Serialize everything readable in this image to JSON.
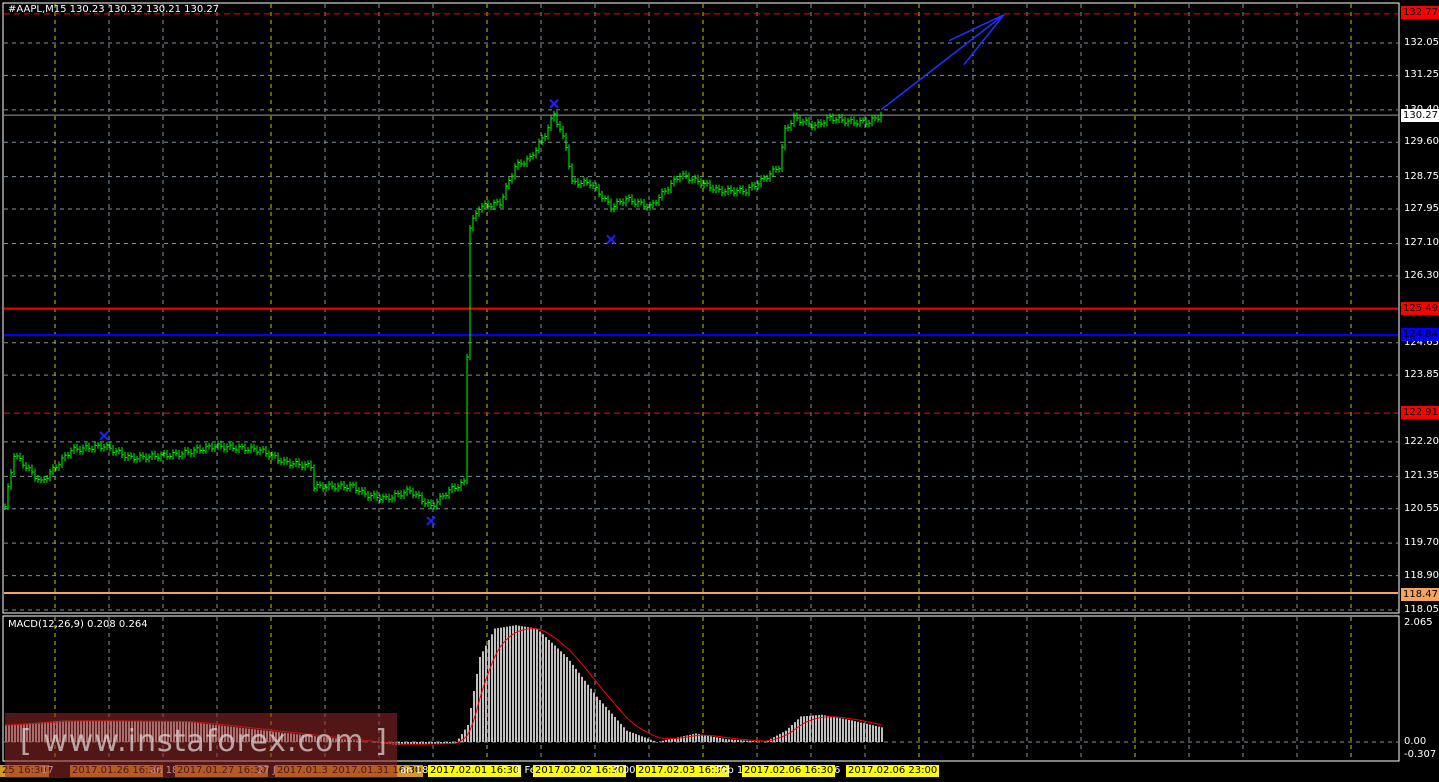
{
  "header": {
    "symbol_info": "#AAPL,M15  130.23 130.32 130.21 130.27"
  },
  "macd": {
    "label": "MACD(12,26,9) 0.208 0.264",
    "axis": [
      "2.065",
      "0.00",
      "-0.307"
    ]
  },
  "price_axis": [
    "132.05",
    "131.25",
    "130.40",
    "129.60",
    "128.75",
    "127.95",
    "127.10",
    "126.30",
    "124.65",
    "123.85",
    "122.20",
    "121.35",
    "120.55",
    "119.70",
    "118.90",
    "118.05"
  ],
  "levels": {
    "target": {
      "value": "132.77",
      "color": "#ff0000"
    },
    "current": {
      "value": "130.27",
      "color": "#ffffff"
    },
    "resistance": {
      "value": "125.49",
      "color": "#ff0000"
    },
    "pivot": {
      "value": "124.84",
      "color": "#0000ff"
    },
    "support_dashed": {
      "value": "122.91",
      "color": "#ff0000"
    },
    "support": {
      "value": "118.47",
      "color": "#f4a460"
    }
  },
  "time_axis": [
    {
      "t": "25 16:30",
      "bg": "#d89a1c"
    },
    {
      "t": "17",
      "bg": ""
    },
    {
      "t": "2017.01.26 16:30",
      "bg": "#d89a1c"
    },
    {
      "t": "an 18",
      "bg": ""
    },
    {
      "t": "2017.01.27 16:30",
      "bg": "#d89a1c"
    },
    {
      "t": "27 J",
      "bg": ""
    },
    {
      "t": "2017.01.3",
      "bg": "#d89a1c"
    },
    {
      "t": "2017.01.31 16:30",
      "bg": "#d89a1c"
    },
    {
      "t": "an 18",
      "bg": ""
    },
    {
      "t": "2017.02.01 16:30",
      "bg": "#ffff00"
    },
    {
      "t": "1 Fe",
      "bg": ""
    },
    {
      "t": "2017.02.02 16:30",
      "bg": "#ffff00"
    },
    {
      "t": "7:00",
      "bg": ""
    },
    {
      "t": "2017.02.03 16:30",
      "bg": "#ffff00"
    },
    {
      "t": "Feb 1",
      "bg": ""
    },
    {
      "t": "2017.02.06 16:30",
      "bg": "#ffff00"
    },
    {
      "t": "6",
      "bg": ""
    },
    {
      "t": "2017.02.06 23:00",
      "bg": "#ffff00"
    }
  ],
  "watermark": "[ www.instaforex.com ]",
  "chart_data": {
    "type": "line",
    "price_keypoints": [
      [
        0,
        120.6
      ],
      [
        3,
        121.9
      ],
      [
        12,
        121.2
      ],
      [
        22,
        122.0
      ],
      [
        33,
        122.1
      ],
      [
        42,
        121.8
      ],
      [
        58,
        121.9
      ],
      [
        70,
        122.1
      ],
      [
        85,
        122.0
      ],
      [
        93,
        121.7
      ],
      [
        102,
        121.6
      ],
      [
        103,
        121.1
      ],
      [
        116,
        121.1
      ],
      [
        120,
        120.9
      ],
      [
        127,
        120.8
      ],
      [
        135,
        121.0
      ],
      [
        142,
        120.6
      ],
      [
        148,
        121.0
      ],
      [
        153,
        121.2
      ],
      [
        155,
        127.5
      ],
      [
        158,
        128.0
      ],
      [
        165,
        128.1
      ],
      [
        170,
        129.0
      ],
      [
        175,
        129.2
      ],
      [
        180,
        129.8
      ],
      [
        183,
        130.3
      ],
      [
        187,
        129.5
      ],
      [
        189,
        128.6
      ],
      [
        195,
        128.6
      ],
      [
        202,
        128.0
      ],
      [
        207,
        128.2
      ],
      [
        215,
        128.0
      ],
      [
        220,
        128.4
      ],
      [
        225,
        128.8
      ],
      [
        232,
        128.6
      ],
      [
        238,
        128.4
      ],
      [
        247,
        128.4
      ],
      [
        253,
        128.7
      ],
      [
        258,
        129.0
      ],
      [
        260,
        129.9
      ],
      [
        263,
        130.2
      ],
      [
        270,
        130.0
      ],
      [
        275,
        130.2
      ],
      [
        282,
        130.1
      ],
      [
        288,
        130.1
      ],
      [
        292,
        130.27
      ]
    ],
    "macd_keypoints": [
      [
        0,
        0.3
      ],
      [
        20,
        0.38
      ],
      [
        60,
        0.36
      ],
      [
        100,
        0.12
      ],
      [
        130,
        -0.05
      ],
      [
        150,
        -0.02
      ],
      [
        154,
        0.3
      ],
      [
        158,
        1.5
      ],
      [
        163,
        2.0
      ],
      [
        170,
        2.06
      ],
      [
        177,
        2.0
      ],
      [
        187,
        1.5
      ],
      [
        197,
        0.8
      ],
      [
        207,
        0.2
      ],
      [
        217,
        0.0
      ],
      [
        230,
        0.15
      ],
      [
        240,
        0.05
      ],
      [
        253,
        0.0
      ],
      [
        260,
        0.2
      ],
      [
        265,
        0.45
      ],
      [
        272,
        0.48
      ],
      [
        282,
        0.38
      ],
      [
        292,
        0.26
      ]
    ],
    "markers": [
      [
        33,
        122.35
      ],
      [
        142,
        120.25
      ],
      [
        183,
        130.55
      ],
      [
        202,
        127.2
      ]
    ],
    "arrow": {
      "from": [
        292,
        130.4
      ],
      "to": [
        330,
        132.75
      ]
    }
  }
}
